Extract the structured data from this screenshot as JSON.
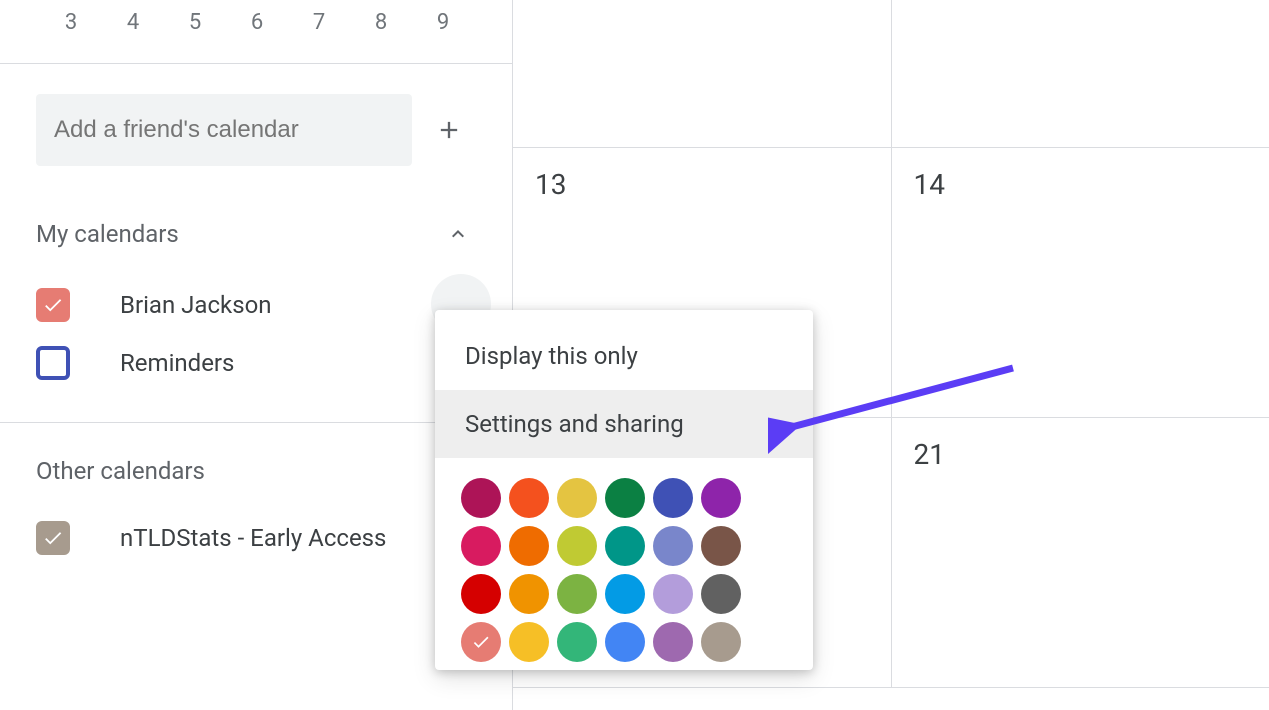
{
  "mini_week": [
    "3",
    "4",
    "5",
    "6",
    "7",
    "8",
    "9"
  ],
  "add_friend": {
    "placeholder": "Add a friend's calendar"
  },
  "sections": {
    "my_calendars_title": "My calendars",
    "other_calendars_title": "Other calendars"
  },
  "my_calendars": [
    {
      "label": "Brian Jackson",
      "checked": true,
      "color": "#e67c73",
      "border": "#e67c73"
    },
    {
      "label": "Reminders",
      "checked": false,
      "color": "#3f51b5",
      "border": "#3f51b5"
    }
  ],
  "other_calendars": [
    {
      "label": "nTLDStats - Early Access",
      "checked": true,
      "color": "#a79b8e",
      "border": "#a79b8e"
    }
  ],
  "context_menu": {
    "display_only": "Display this only",
    "settings_sharing": "Settings and sharing",
    "colors": [
      "#ad1457",
      "#f4511e",
      "#e4c441",
      "#0b8043",
      "#3f51b5",
      "#8e24aa",
      "#d81b60",
      "#ef6c00",
      "#c0ca33",
      "#009688",
      "#7986cb",
      "#795548",
      "#d50000",
      "#f09300",
      "#7cb342",
      "#039be5",
      "#b39ddb",
      "#616161",
      "#e67c73",
      "#f6bf26",
      "#33b679",
      "#4285f4",
      "#9e69af",
      "#a79b8e"
    ],
    "selected_color_index": 18
  },
  "grid": {
    "rows": [
      [
        "",
        ""
      ],
      [
        "13",
        "14"
      ],
      [
        "",
        "21"
      ]
    ]
  }
}
